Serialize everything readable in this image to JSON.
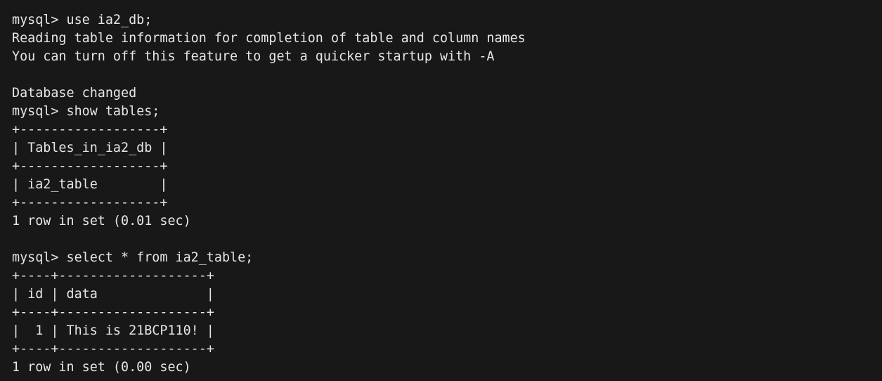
{
  "terminal": {
    "lines": [
      "mysql> use ia2_db;",
      "Reading table information for completion of table and column names",
      "You can turn off this feature to get a quicker startup with -A",
      "",
      "Database changed",
      "mysql> show tables;",
      "+------------------+",
      "| Tables_in_ia2_db |",
      "+------------------+",
      "| ia2_table        |",
      "+------------------+",
      "1 row in set (0.01 sec)",
      "",
      "mysql> select * from ia2_table;",
      "+----+-------------------+",
      "| id | data              |",
      "+----+-------------------+",
      "|  1 | This is 21BCP110! |",
      "+----+-------------------+",
      "1 row in set (0.00 sec)"
    ]
  },
  "colors": {
    "background": "#181818",
    "text": "#e6e6e6"
  }
}
